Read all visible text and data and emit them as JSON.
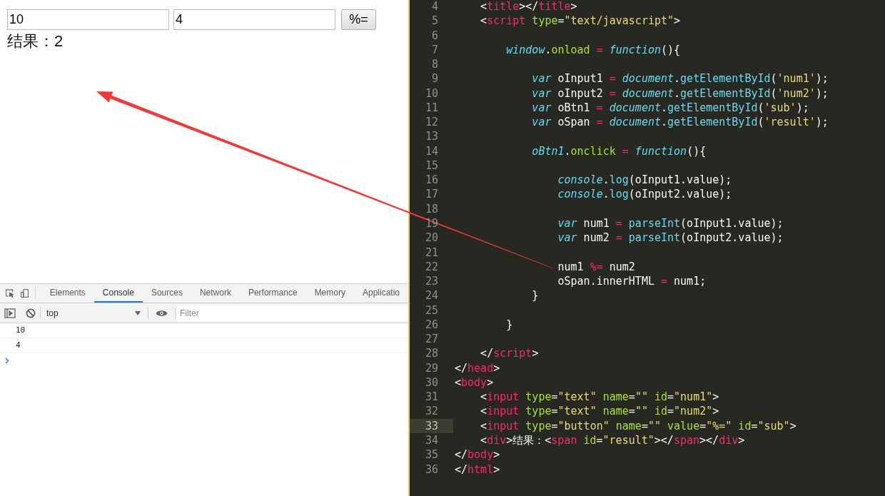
{
  "page": {
    "inputs": [
      {
        "value": "10"
      },
      {
        "value": "4"
      }
    ],
    "button": "%=",
    "result": {
      "label": "结果：",
      "value": "2"
    }
  },
  "devtools": {
    "tabs": [
      {
        "label": "Elements",
        "selected": false
      },
      {
        "label": "Console",
        "selected": true
      },
      {
        "label": "Sources",
        "selected": false
      },
      {
        "label": "Network",
        "selected": false
      },
      {
        "label": "Performance",
        "selected": false
      },
      {
        "label": "Memory",
        "selected": false
      },
      {
        "label": "Applicatio",
        "selected": false
      }
    ],
    "context": "top",
    "filter": {
      "placeholder": "Filter"
    },
    "console_lines": [
      "10",
      "4"
    ]
  },
  "editor": {
    "lines": [
      {
        "number": "4",
        "current": false,
        "tokens": [
          {
            "kind": "plain",
            "t": "    <"
          },
          {
            "kind": "tag",
            "t": "title"
          },
          {
            "kind": "plain",
            "t": "></"
          },
          {
            "kind": "tag",
            "t": "title"
          },
          {
            "kind": "plain",
            "t": ">"
          }
        ]
      },
      {
        "number": "5",
        "current": false,
        "tokens": [
          {
            "kind": "plain",
            "t": "    <"
          },
          {
            "kind": "tag",
            "t": "script"
          },
          {
            "kind": "attr",
            "t": " type"
          },
          {
            "kind": "plain",
            "t": "="
          },
          {
            "kind": "string",
            "t": "\"text/javascript\""
          },
          {
            "kind": "plain",
            "t": ">"
          }
        ]
      },
      {
        "number": "6",
        "current": false
      },
      {
        "number": "7",
        "current": false,
        "tokens": [
          {
            "kind": "keyword",
            "t": "        window"
          },
          {
            "kind": "plain",
            "t": "."
          },
          {
            "kind": "method",
            "t": "onload"
          },
          {
            "kind": "operator",
            "t": " ="
          },
          {
            "kind": "keyword",
            "t": " function"
          },
          {
            "kind": "plain",
            "t": "(){"
          }
        ]
      },
      {
        "number": "8",
        "current": false
      },
      {
        "number": "9",
        "current": false,
        "tokens": [
          {
            "kind": "keyword",
            "t": "            var"
          },
          {
            "kind": "plain",
            "t": " oInput1"
          },
          {
            "kind": "operator",
            "t": " ="
          },
          {
            "kind": "keyword",
            "t": " document"
          },
          {
            "kind": "plain",
            "t": "."
          },
          {
            "kind": "call",
            "t": "getElementById"
          },
          {
            "kind": "plain",
            "t": "("
          },
          {
            "kind": "string",
            "t": "'num1'"
          },
          {
            "kind": "plain",
            "t": ");"
          }
        ]
      },
      {
        "number": "10",
        "current": false,
        "tokens": [
          {
            "kind": "keyword",
            "t": "            var"
          },
          {
            "kind": "plain",
            "t": " oInput2"
          },
          {
            "kind": "operator",
            "t": " ="
          },
          {
            "kind": "keyword",
            "t": " document"
          },
          {
            "kind": "plain",
            "t": "."
          },
          {
            "kind": "call",
            "t": "getElementById"
          },
          {
            "kind": "plain",
            "t": "("
          },
          {
            "kind": "string",
            "t": "'num2'"
          },
          {
            "kind": "plain",
            "t": ");"
          }
        ]
      },
      {
        "number": "11",
        "current": false,
        "tokens": [
          {
            "kind": "keyword",
            "t": "            var"
          },
          {
            "kind": "plain",
            "t": " oBtn1"
          },
          {
            "kind": "operator",
            "t": " ="
          },
          {
            "kind": "keyword",
            "t": " document"
          },
          {
            "kind": "plain",
            "t": "."
          },
          {
            "kind": "call",
            "t": "getElementById"
          },
          {
            "kind": "plain",
            "t": "("
          },
          {
            "kind": "string",
            "t": "'sub'"
          },
          {
            "kind": "plain",
            "t": ");"
          }
        ]
      },
      {
        "number": "12",
        "current": false,
        "tokens": [
          {
            "kind": "keyword",
            "t": "            var"
          },
          {
            "kind": "plain",
            "t": " oSpan"
          },
          {
            "kind": "operator",
            "t": " ="
          },
          {
            "kind": "keyword",
            "t": " document"
          },
          {
            "kind": "plain",
            "t": "."
          },
          {
            "kind": "call",
            "t": "getElementById"
          },
          {
            "kind": "plain",
            "t": "("
          },
          {
            "kind": "string",
            "t": "'result'"
          },
          {
            "kind": "plain",
            "t": ");"
          }
        ]
      },
      {
        "number": "13",
        "current": false
      },
      {
        "number": "14",
        "current": false,
        "tokens": [
          {
            "kind": "keyword",
            "t": "            oBtn1"
          },
          {
            "kind": "plain",
            "t": "."
          },
          {
            "kind": "method",
            "t": "onclick"
          },
          {
            "kind": "operator",
            "t": " ="
          },
          {
            "kind": "keyword",
            "t": " function"
          },
          {
            "kind": "plain",
            "t": "(){"
          }
        ]
      },
      {
        "number": "15",
        "current": false
      },
      {
        "number": "16",
        "current": false,
        "tokens": [
          {
            "kind": "keyword",
            "t": "                console"
          },
          {
            "kind": "plain",
            "t": "."
          },
          {
            "kind": "call",
            "t": "log"
          },
          {
            "kind": "plain",
            "t": "(oInput1.value);"
          }
        ]
      },
      {
        "number": "17",
        "current": false,
        "tokens": [
          {
            "kind": "keyword",
            "t": "                console"
          },
          {
            "kind": "plain",
            "t": "."
          },
          {
            "kind": "call",
            "t": "log"
          },
          {
            "kind": "plain",
            "t": "(oInput2.value);"
          }
        ]
      },
      {
        "number": "18",
        "current": false
      },
      {
        "number": "19",
        "current": false,
        "tokens": [
          {
            "kind": "keyword",
            "t": "                var"
          },
          {
            "kind": "plain",
            "t": " num1"
          },
          {
            "kind": "operator",
            "t": " ="
          },
          {
            "kind": "call",
            "t": " parseInt"
          },
          {
            "kind": "plain",
            "t": "(oInput1.value);"
          }
        ]
      },
      {
        "number": "20",
        "current": false,
        "tokens": [
          {
            "kind": "keyword",
            "t": "                var"
          },
          {
            "kind": "plain",
            "t": " num2"
          },
          {
            "kind": "operator",
            "t": " ="
          },
          {
            "kind": "call",
            "t": " parseInt"
          },
          {
            "kind": "plain",
            "t": "(oInput2.value);"
          }
        ]
      },
      {
        "number": "21",
        "current": false
      },
      {
        "number": "22",
        "current": false,
        "tokens": [
          {
            "kind": "plain",
            "t": "                num1"
          },
          {
            "kind": "operator",
            "t": " %="
          },
          {
            "kind": "plain",
            "t": " num2"
          }
        ]
      },
      {
        "number": "23",
        "current": false,
        "tokens": [
          {
            "kind": "plain",
            "t": "                oSpan.innerHTML"
          },
          {
            "kind": "operator",
            "t": " ="
          },
          {
            "kind": "plain",
            "t": " num1;"
          }
        ]
      },
      {
        "number": "24",
        "current": false,
        "tokens": [
          {
            "kind": "plain",
            "t": "            }"
          }
        ]
      },
      {
        "number": "25",
        "current": false
      },
      {
        "number": "26",
        "current": false,
        "tokens": [
          {
            "kind": "plain",
            "t": "        }"
          }
        ]
      },
      {
        "number": "27",
        "current": false
      },
      {
        "number": "28",
        "current": false,
        "tokens": [
          {
            "kind": "plain",
            "t": "    </"
          },
          {
            "kind": "tag",
            "t": "script"
          },
          {
            "kind": "plain",
            "t": ">"
          }
        ]
      },
      {
        "number": "29",
        "current": false,
        "tokens": [
          {
            "kind": "plain",
            "t": "</"
          },
          {
            "kind": "tag",
            "t": "head"
          },
          {
            "kind": "plain",
            "t": ">"
          }
        ]
      },
      {
        "number": "30",
        "current": false,
        "tokens": [
          {
            "kind": "plain",
            "t": "<"
          },
          {
            "kind": "tag",
            "t": "body"
          },
          {
            "kind": "plain",
            "t": ">"
          }
        ]
      },
      {
        "number": "31",
        "current": false,
        "tokens": [
          {
            "kind": "plain",
            "t": "    <"
          },
          {
            "kind": "tag",
            "t": "input"
          },
          {
            "kind": "attr",
            "t": " type"
          },
          {
            "kind": "plain",
            "t": "="
          },
          {
            "kind": "string",
            "t": "\"text\""
          },
          {
            "kind": "attr",
            "t": " name"
          },
          {
            "kind": "plain",
            "t": "="
          },
          {
            "kind": "string",
            "t": "\"\""
          },
          {
            "kind": "attr",
            "t": " id"
          },
          {
            "kind": "plain",
            "t": "="
          },
          {
            "kind": "string",
            "t": "\"num1\""
          },
          {
            "kind": "plain",
            "t": ">"
          }
        ]
      },
      {
        "number": "32",
        "current": false,
        "tokens": [
          {
            "kind": "plain",
            "t": "    <"
          },
          {
            "kind": "tag",
            "t": "input"
          },
          {
            "kind": "attr",
            "t": " type"
          },
          {
            "kind": "plain",
            "t": "="
          },
          {
            "kind": "string",
            "t": "\"text\""
          },
          {
            "kind": "attr",
            "t": " name"
          },
          {
            "kind": "plain",
            "t": "="
          },
          {
            "kind": "string",
            "t": "\"\""
          },
          {
            "kind": "attr",
            "t": " id"
          },
          {
            "kind": "plain",
            "t": "="
          },
          {
            "kind": "string",
            "t": "\"num2\""
          },
          {
            "kind": "plain",
            "t": ">"
          }
        ]
      },
      {
        "number": "33",
        "current": true,
        "tokens": [
          {
            "kind": "plain",
            "t": "    <"
          },
          {
            "kind": "tag",
            "t": "input"
          },
          {
            "kind": "attr",
            "t": " type"
          },
          {
            "kind": "plain",
            "t": "="
          },
          {
            "kind": "string",
            "t": "\"button\""
          },
          {
            "kind": "attr",
            "t": " name"
          },
          {
            "kind": "plain",
            "t": "="
          },
          {
            "kind": "string",
            "t": "\"\""
          },
          {
            "kind": "attr",
            "t": " value"
          },
          {
            "kind": "plain",
            "t": "="
          },
          {
            "kind": "string",
            "t": "\"%=\""
          },
          {
            "kind": "attr",
            "t": " id"
          },
          {
            "kind": "plain",
            "t": "="
          },
          {
            "kind": "string",
            "t": "\"sub\""
          },
          {
            "kind": "plain",
            "t": ">"
          }
        ]
      },
      {
        "number": "34",
        "current": false,
        "tokens": [
          {
            "kind": "plain",
            "t": "    <"
          },
          {
            "kind": "tag",
            "t": "div"
          },
          {
            "kind": "plain",
            "t": ">结果：<"
          },
          {
            "kind": "tag",
            "t": "span"
          },
          {
            "kind": "attr",
            "t": " id"
          },
          {
            "kind": "plain",
            "t": "="
          },
          {
            "kind": "string",
            "t": "\"result\""
          },
          {
            "kind": "plain",
            "t": "></"
          },
          {
            "kind": "tag",
            "t": "span"
          },
          {
            "kind": "plain",
            "t": "></"
          },
          {
            "kind": "tag",
            "t": "div"
          },
          {
            "kind": "plain",
            "t": ">"
          }
        ]
      },
      {
        "number": "35",
        "current": false,
        "tokens": [
          {
            "kind": "plain",
            "t": "</"
          },
          {
            "kind": "tag",
            "t": "body"
          },
          {
            "kind": "plain",
            "t": ">"
          }
        ]
      },
      {
        "number": "36",
        "current": false,
        "tokens": [
          {
            "kind": "plain",
            "t": "</"
          },
          {
            "kind": "tag",
            "t": "html"
          },
          {
            "kind": "plain",
            "t": ">"
          }
        ]
      }
    ]
  }
}
